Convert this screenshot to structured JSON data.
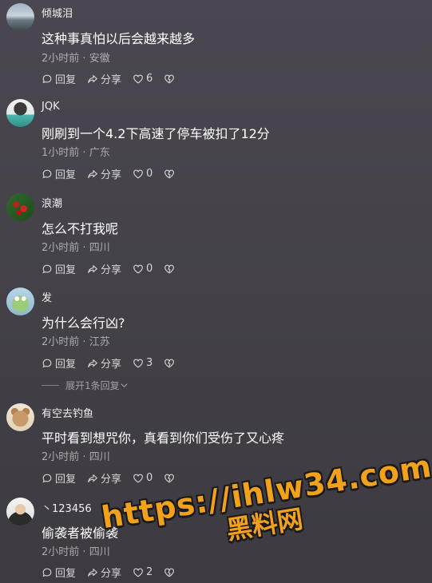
{
  "comments": [
    {
      "username": "倾城泪",
      "text": "这种事真怕以后会越来越多",
      "time": "2小时前",
      "location": "安徽",
      "reply": "回复",
      "share": "分享",
      "likes": "6",
      "avatar": "landscape"
    },
    {
      "username": "JQK",
      "text": "刚刷到一个4.2下高速了停车被扣了12分",
      "time": "1小时前",
      "location": "广东",
      "reply": "回复",
      "share": "分享",
      "likes": "0",
      "avatar": "truck"
    },
    {
      "username": "浪潮",
      "text": "怎么不打我呢",
      "time": "2小时前",
      "location": "四川",
      "reply": "回复",
      "share": "分享",
      "likes": "0",
      "avatar": "berries"
    },
    {
      "username": "发",
      "text": "为什么会行凶?",
      "time": "2小时前",
      "location": "江苏",
      "reply": "回复",
      "share": "分享",
      "likes": "3",
      "avatar": "cartoon-frog"
    },
    {
      "username": "有空去钓鱼",
      "text": "平时看到想咒你，真看到你们受伤了又心疼",
      "time": "2小时前",
      "location": "四川",
      "reply": "回复",
      "share": "分享",
      "likes": "0",
      "avatar": "cartoon-dog"
    },
    {
      "username": "丶123456",
      "text": "偷袭者被偷袭",
      "time": "2小时前",
      "location": "四川",
      "reply": "回复",
      "share": "分享",
      "likes": "2",
      "avatar": "person"
    }
  ],
  "expand_replies": "展开1条回复",
  "meta_separator": "·",
  "watermark": {
    "url": "https://ihlw34.com",
    "name": "黑料网",
    "color": "#f2a21a"
  }
}
